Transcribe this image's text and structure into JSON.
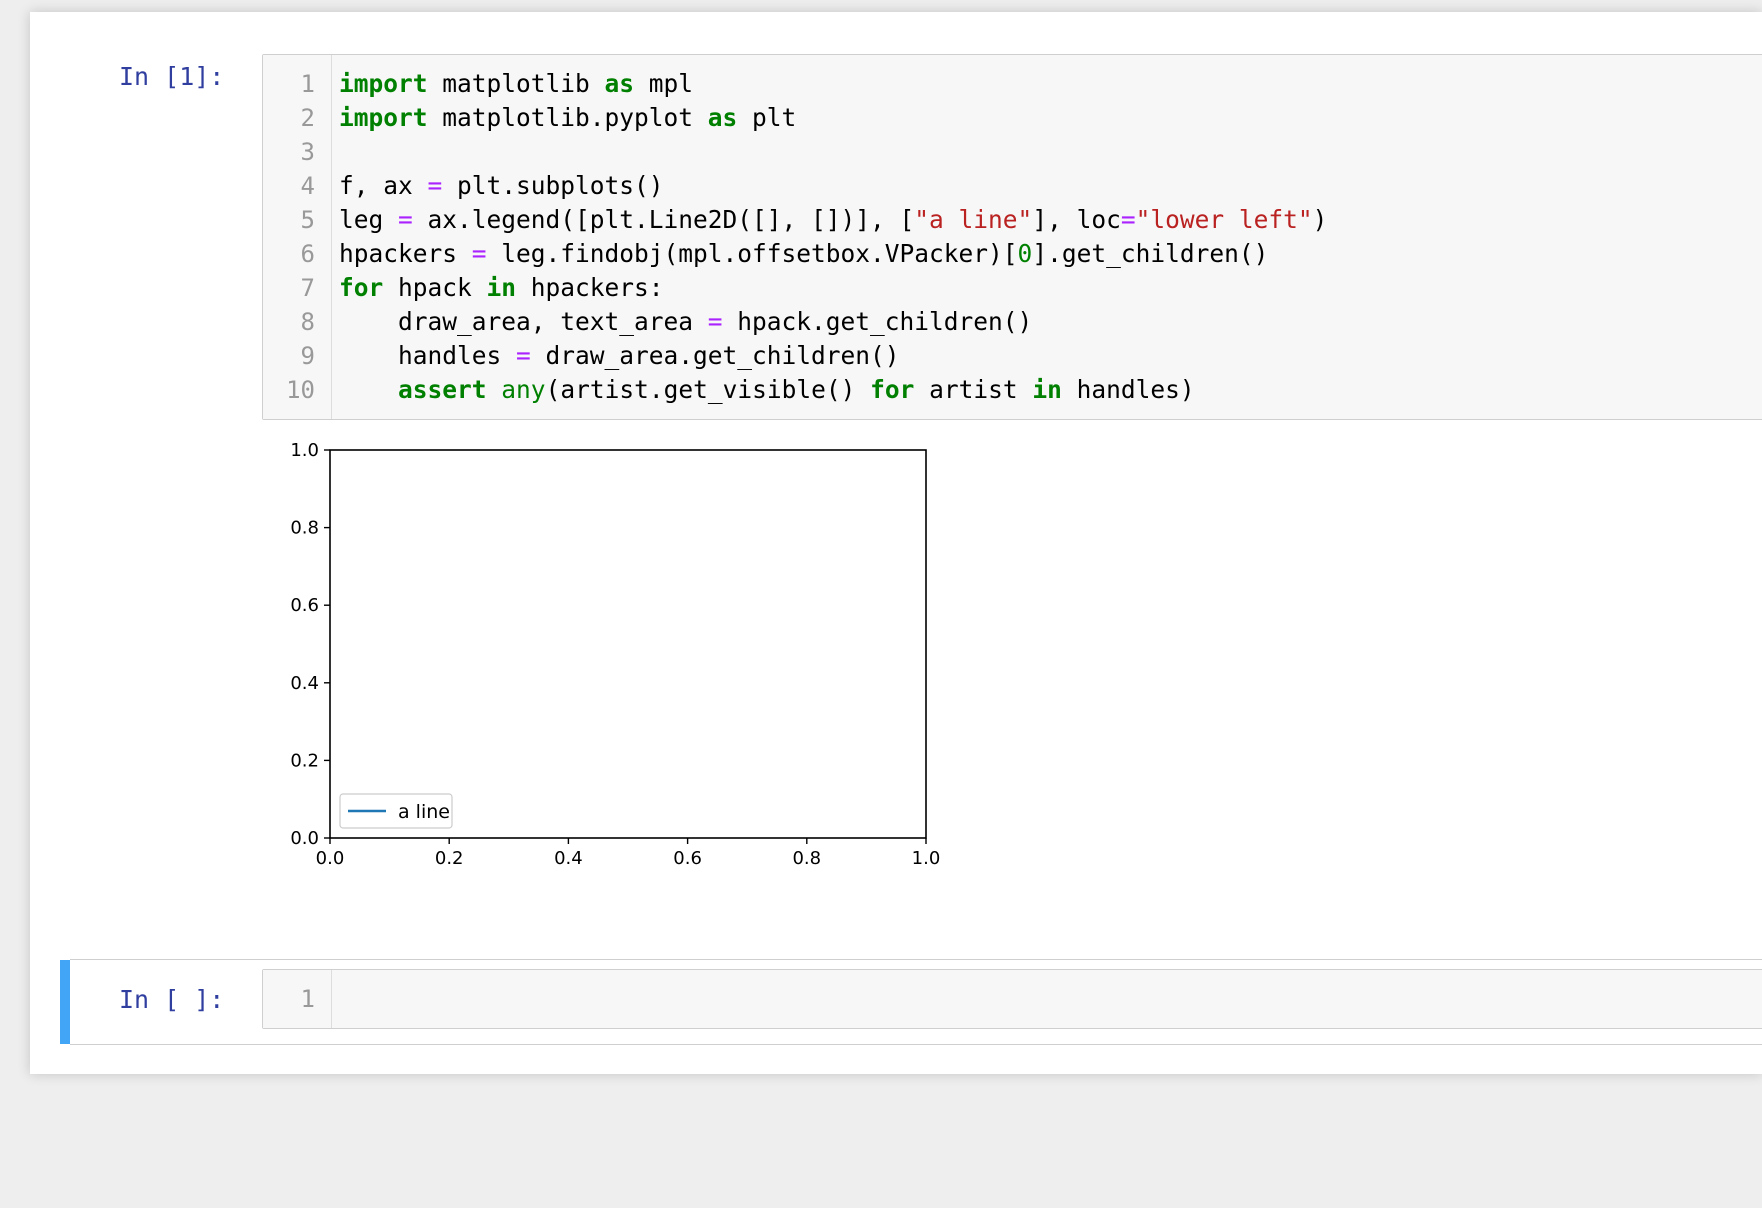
{
  "cells": [
    {
      "prompt": "In [1]:",
      "lines": [
        {
          "num": "1",
          "tokens": [
            {
              "t": "kw",
              "v": "import"
            },
            {
              "t": "plain",
              "v": " matplotlib "
            },
            {
              "t": "kw",
              "v": "as"
            },
            {
              "t": "plain",
              "v": " mpl"
            }
          ]
        },
        {
          "num": "2",
          "tokens": [
            {
              "t": "kw",
              "v": "import"
            },
            {
              "t": "plain",
              "v": " matplotlib.pyplot "
            },
            {
              "t": "kw",
              "v": "as"
            },
            {
              "t": "plain",
              "v": " plt"
            }
          ]
        },
        {
          "num": "3",
          "tokens": []
        },
        {
          "num": "4",
          "tokens": [
            {
              "t": "plain",
              "v": "f, ax "
            },
            {
              "t": "op",
              "v": "="
            },
            {
              "t": "plain",
              "v": " plt.subplots()"
            }
          ]
        },
        {
          "num": "5",
          "tokens": [
            {
              "t": "plain",
              "v": "leg "
            },
            {
              "t": "op",
              "v": "="
            },
            {
              "t": "plain",
              "v": " ax.legend([plt.Line2D([], [])], ["
            },
            {
              "t": "str",
              "v": "\"a line\""
            },
            {
              "t": "plain",
              "v": "], loc"
            },
            {
              "t": "op",
              "v": "="
            },
            {
              "t": "str",
              "v": "\"lower left\""
            },
            {
              "t": "plain",
              "v": ")"
            }
          ]
        },
        {
          "num": "6",
          "tokens": [
            {
              "t": "plain",
              "v": "hpackers "
            },
            {
              "t": "op",
              "v": "="
            },
            {
              "t": "plain",
              "v": " leg.findobj(mpl.offsetbox.VPacker)["
            },
            {
              "t": "num",
              "v": "0"
            },
            {
              "t": "plain",
              "v": "].get_children()"
            }
          ]
        },
        {
          "num": "7",
          "tokens": [
            {
              "t": "kw",
              "v": "for"
            },
            {
              "t": "plain",
              "v": " hpack "
            },
            {
              "t": "kw",
              "v": "in"
            },
            {
              "t": "plain",
              "v": " hpackers:"
            }
          ]
        },
        {
          "num": "8",
          "tokens": [
            {
              "t": "plain",
              "v": "    draw_area, text_area "
            },
            {
              "t": "op",
              "v": "="
            },
            {
              "t": "plain",
              "v": " hpack.get_children()"
            }
          ]
        },
        {
          "num": "9",
          "tokens": [
            {
              "t": "plain",
              "v": "    handles "
            },
            {
              "t": "op",
              "v": "="
            },
            {
              "t": "plain",
              "v": " draw_area.get_children()"
            }
          ]
        },
        {
          "num": "10",
          "tokens": [
            {
              "t": "plain",
              "v": "    "
            },
            {
              "t": "kw",
              "v": "assert"
            },
            {
              "t": "plain",
              "v": " "
            },
            {
              "t": "builtin",
              "v": "any"
            },
            {
              "t": "plain",
              "v": "(artist.get_visible() "
            },
            {
              "t": "kw",
              "v": "for"
            },
            {
              "t": "plain",
              "v": " artist "
            },
            {
              "t": "kw",
              "v": "in"
            },
            {
              "t": "plain",
              "v": " handles)"
            }
          ]
        }
      ]
    },
    {
      "prompt": "In [ ]:",
      "lines": [
        {
          "num": "1",
          "tokens": []
        }
      ]
    }
  ],
  "chart_data": {
    "type": "line",
    "xlim": [
      0.0,
      1.0
    ],
    "ylim": [
      0.0,
      1.0
    ],
    "xticks": [
      "0.0",
      "0.2",
      "0.4",
      "0.6",
      "0.8",
      "1.0"
    ],
    "yticks": [
      "0.0",
      "0.2",
      "0.4",
      "0.6",
      "0.8",
      "1.0"
    ],
    "series": [
      {
        "name": "a line",
        "x": [],
        "y": [],
        "color": "#1f77b4"
      }
    ],
    "legend": {
      "loc": "lower left",
      "entries": [
        "a line"
      ]
    },
    "grid": false
  },
  "colors": {
    "prompt": "#303f9f",
    "keyword": "#008000",
    "operator": "#aa22ff",
    "string": "#ba2121",
    "selected_cell_bar": "#42a5f5"
  }
}
